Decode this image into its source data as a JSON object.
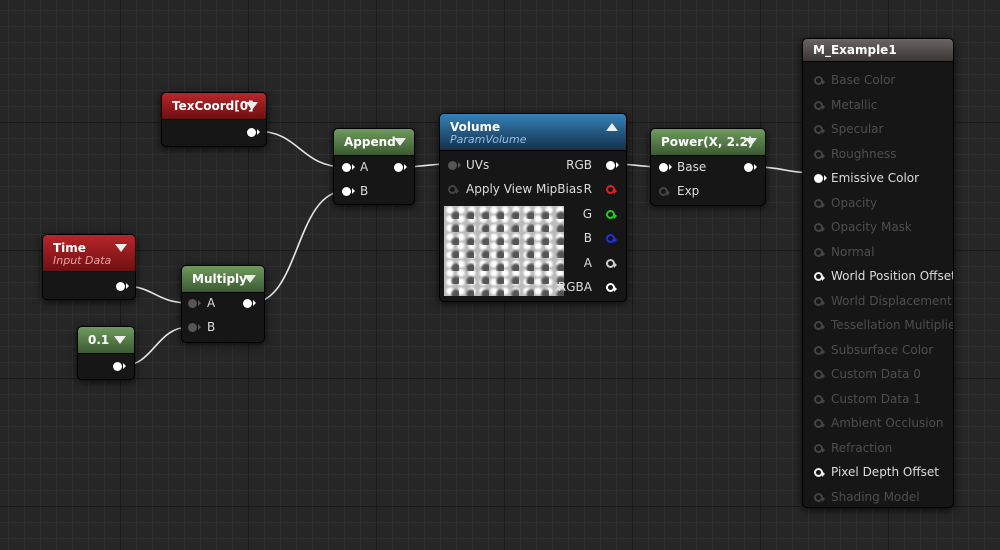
{
  "texcoord": {
    "title": "TexCoord[0]"
  },
  "time": {
    "title": "Time",
    "subtitle": "Input Data"
  },
  "constant": {
    "title": "0.1"
  },
  "multiply": {
    "title": "Multiply",
    "pin_a": "A",
    "pin_b": "B"
  },
  "append": {
    "title": "Append",
    "pin_a": "A",
    "pin_b": "B"
  },
  "volume": {
    "title": "Volume",
    "subtitle": "ParamVolume",
    "inputs": [
      "UVs",
      "Apply View MipBias"
    ],
    "outputs": [
      "RGB",
      "R",
      "G",
      "B",
      "A",
      "RGBA"
    ]
  },
  "power": {
    "title": "Power(X, 2.2)",
    "pin_base": "Base",
    "pin_exp": "Exp"
  },
  "material": {
    "title": "M_Example1",
    "inputs": [
      "Base Color",
      "Metallic",
      "Specular",
      "Roughness",
      "Emissive Color",
      "Opacity",
      "Opacity Mask",
      "Normal",
      "World Position Offset",
      "World Displacement",
      "Tessellation Multiplier",
      "Subsurface Color",
      "Custom Data 0",
      "Custom Data 1",
      "Ambient Occlusion",
      "Refraction",
      "Pixel Depth Offset",
      "Shading Model"
    ]
  }
}
